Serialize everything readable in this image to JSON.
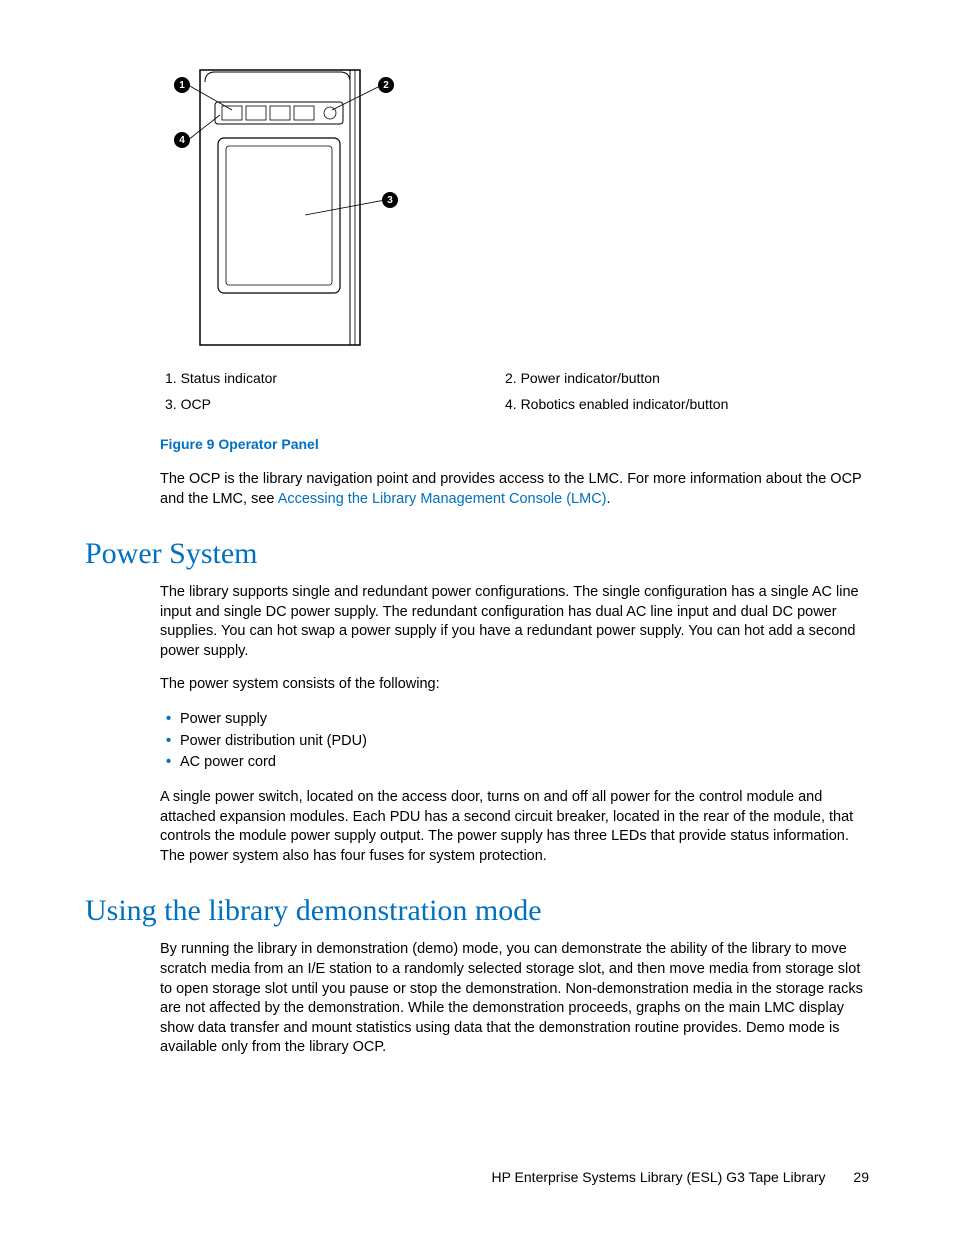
{
  "figure": {
    "callouts": {
      "c1": "1",
      "c2": "2",
      "c3": "3",
      "c4": "4"
    },
    "legend": {
      "item1": "1. Status indicator",
      "item2": "2. Power indicator/button",
      "item3": "3. OCP",
      "item4": "4. Robotics enabled indicator/button"
    },
    "caption": "Figure 9 Operator Panel"
  },
  "intro_paragraph_a": "The OCP is the library navigation point and provides access to the LMC. For more information about the OCP and the LMC, see ",
  "intro_link": "Accessing the Library Management Console (LMC)",
  "intro_paragraph_b": ".",
  "section1": {
    "heading": "Power System",
    "p1": "The library supports single and redundant power configurations. The single configuration has a single AC line input and single DC power supply. The redundant configuration has dual AC line input and dual DC power supplies. You can hot swap a power supply if you have a redundant power supply. You can hot add a second power supply.",
    "p2": "The power system consists of the following:",
    "bullets": {
      "b1": "Power supply",
      "b2": "Power distribution unit (PDU)",
      "b3": "AC power cord"
    },
    "p3": "A single power switch, located on the access door, turns on and off all power for the control module and attached expansion modules. Each PDU has a second circuit breaker, located in the rear of the module, that controls the module power supply output. The power supply has three LEDs that provide status information. The power system also has four fuses for system protection."
  },
  "section2": {
    "heading": "Using the library demonstration mode",
    "p1": "By running the library in demonstration (demo) mode, you can demonstrate the ability of the library to move scratch media from an I/E station to a randomly selected storage slot, and then move media from storage slot to open storage slot until you pause or stop the demonstration. Non-demonstration media in the storage racks are not affected by the demonstration. While the demonstration proceeds, graphs on the main LMC display show data transfer and mount statistics using data that the demonstration routine provides. Demo mode is available only from the library OCP."
  },
  "footer": {
    "title": "HP Enterprise Systems Library (ESL) G3 Tape Library",
    "page": "29"
  }
}
